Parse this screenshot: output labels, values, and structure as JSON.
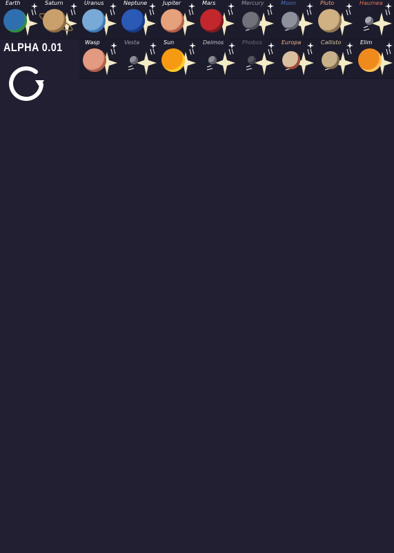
{
  "version_label": "ALPHA 0.01",
  "reload_icon": "refresh-icon",
  "colors": {
    "background": "#221f33",
    "card": "#1d1c2c",
    "spark": "#fff7cf"
  },
  "bodies": [
    {
      "id": "earth",
      "label": "Earth",
      "label_color": "#ffffff",
      "fill": "#2f6fb0",
      "accent": "#2f8f3f",
      "ring": false,
      "size": "large"
    },
    {
      "id": "saturn",
      "label": "Saturn",
      "label_color": "#ffffff",
      "fill": "#c9a06c",
      "accent": "#8a6a43",
      "ring": true,
      "size": "large"
    },
    {
      "id": "uranus",
      "label": "Uranus",
      "label_color": "#ffffff",
      "fill": "#79a9d6",
      "accent": "#3f78b5",
      "ring": false,
      "size": "large"
    },
    {
      "id": "neptune",
      "label": "Neptune",
      "label_color": "#ffffff",
      "fill": "#2a59b6",
      "accent": "#173a86",
      "ring": false,
      "size": "large"
    },
    {
      "id": "jupiter",
      "label": "Jupiter",
      "label_color": "#ffffff",
      "fill": "#e4a17c",
      "accent": "#b75f48",
      "ring": false,
      "size": "large"
    },
    {
      "id": "mars",
      "label": "Mars",
      "label_color": "#ffffff",
      "fill": "#c1272d",
      "accent": "#7c1a1e",
      "ring": false,
      "size": "large"
    },
    {
      "id": "mercury",
      "label": "Mercury",
      "label_color": "#9a9aa6",
      "fill": "#70717b",
      "accent": "#4b4c55",
      "ring": false,
      "size": "medium"
    },
    {
      "id": "moon",
      "label": "Moon",
      "label_color": "#4a74c9",
      "fill": "#8e909c",
      "accent": "#5e606b",
      "ring": false,
      "size": "medium"
    },
    {
      "id": "pluto",
      "label": "Pluto",
      "label_color": "#f0a47d",
      "fill": "#cfb184",
      "accent": "#8f7552",
      "ring": false,
      "size": "large"
    },
    {
      "id": "haumea",
      "label": "Haumea",
      "label_color": "#e0775f",
      "fill": "#a7a7b2",
      "accent": "#6b6b75",
      "ring": false,
      "size": "tiny"
    },
    {
      "id": "wasp",
      "label": "Wasp",
      "label_color": "#ffffff",
      "fill": "#e29a80",
      "accent": "#b2604c",
      "ring": false,
      "size": "large"
    },
    {
      "id": "vesta",
      "label": "Vesta",
      "label_color": "#9a9aa6",
      "fill": "#8b8c96",
      "accent": "#5c5d67",
      "ring": false,
      "size": "tiny"
    },
    {
      "id": "sun",
      "label": "Sun",
      "label_color": "#ffffff",
      "fill": "#f59a12",
      "accent": "#ffcc2a",
      "ring": false,
      "size": "large"
    },
    {
      "id": "deimos",
      "label": "Deimos",
      "label_color": "#c7c7d1",
      "fill": "#8a8b95",
      "accent": "#5c5d67",
      "ring": false,
      "size": "tiny"
    },
    {
      "id": "phobos",
      "label": "Phobos",
      "label_color": "#6a6a78",
      "fill": "#55565f",
      "accent": "#3a3b44",
      "ring": false,
      "size": "tiny"
    },
    {
      "id": "europa",
      "label": "Europa",
      "label_color": "#f3b08a",
      "fill": "#d8bfa0",
      "accent": "#9a4a32",
      "ring": false,
      "size": "medium"
    },
    {
      "id": "callisto",
      "label": "Callisto",
      "label_color": "#d9c9a0",
      "fill": "#c7b08a",
      "accent": "#7d6a4b",
      "ring": false,
      "size": "medium"
    },
    {
      "id": "elim",
      "label": "Elim",
      "label_color": "#ffffff",
      "fill": "#ef8a1d",
      "accent": "#ffc35a",
      "ring": false,
      "size": "large"
    }
  ]
}
